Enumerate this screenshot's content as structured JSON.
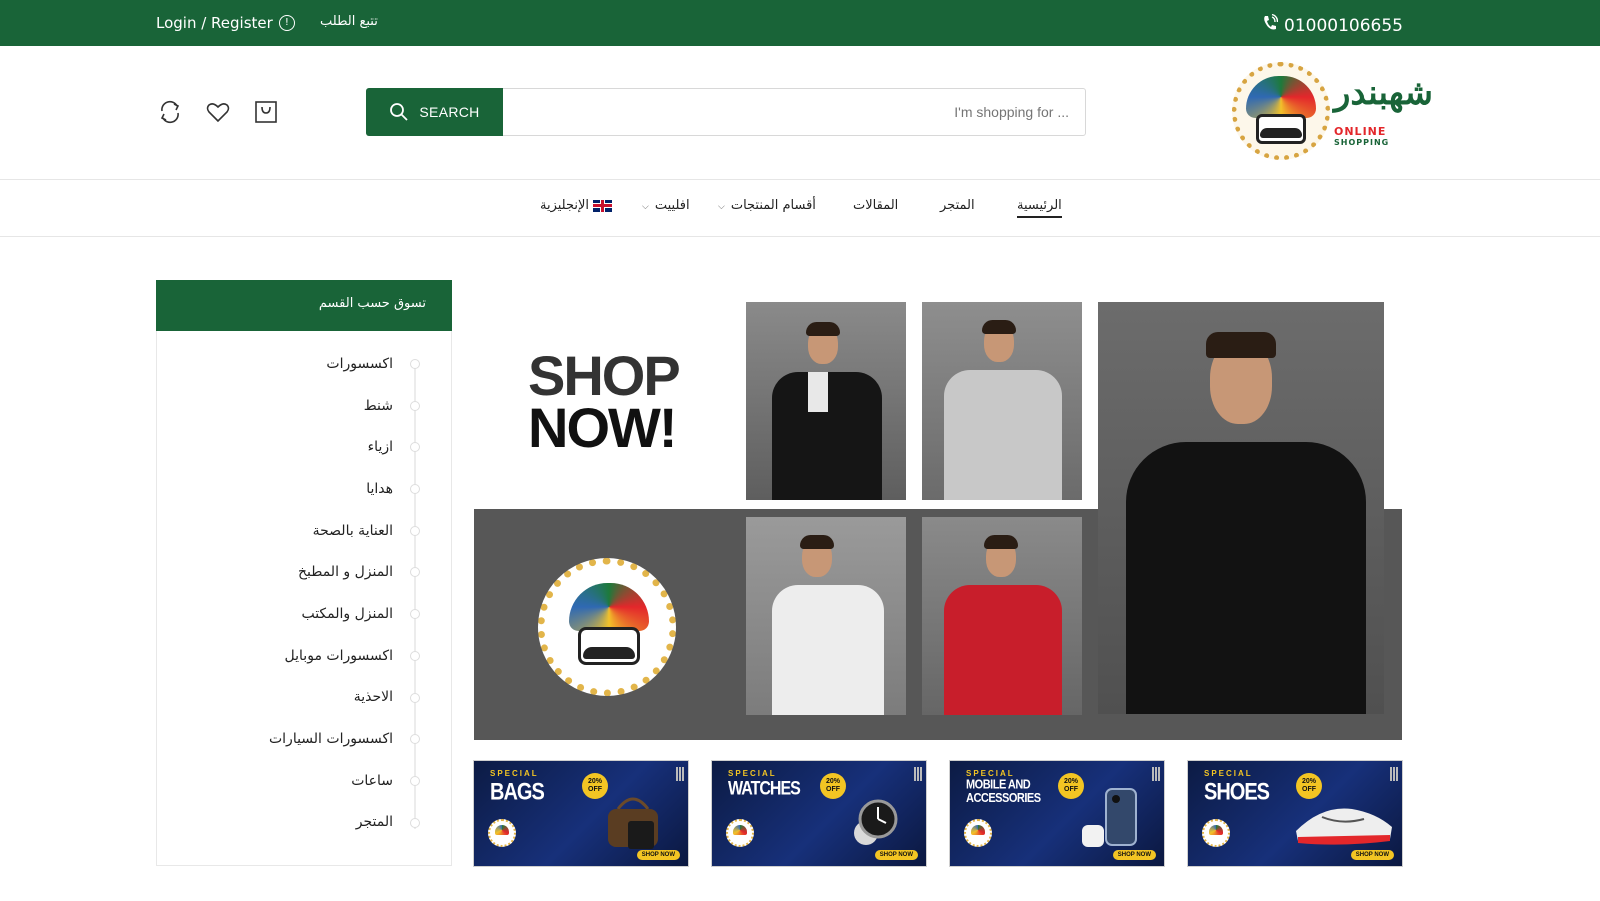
{
  "topbar": {
    "login_label": "Login / Register",
    "track_label": "تتبع الطلب",
    "phone": "01000106655"
  },
  "header": {
    "search_button": "SEARCH",
    "search_placeholder": "... I'm shopping for",
    "icons": [
      "refresh-icon",
      "heart-icon",
      "bag-icon"
    ],
    "logo": {
      "arabic_word": "شهبندر",
      "line1": "ONLINE",
      "line2": "SHOPPING"
    }
  },
  "nav": {
    "items": [
      {
        "label": "الرئيسية",
        "active": true
      },
      {
        "label": "المتجر"
      },
      {
        "label": "المقالات"
      },
      {
        "label": "أقسام المنتجات",
        "dropdown": true
      },
      {
        "label": "افلييت",
        "dropdown": true
      },
      {
        "label": "الإنجليزية",
        "flag": "uk"
      }
    ]
  },
  "categories": {
    "title": "تسوق حسب القسم",
    "items": [
      "اكسسورات",
      "شنط",
      "ازياء",
      "هدايا",
      "العناية بالصحة",
      "المنزل و المطبخ",
      "المنزل والمكتب",
      "اكسسورات موبايل",
      "الاحذية",
      "اكسسورات السيارات",
      "ساعات",
      "المتجر"
    ]
  },
  "hero": {
    "line1": "SHOP",
    "line2": "NOW!"
  },
  "promos": [
    {
      "special": "SPECIAL",
      "name": "BAGS",
      "off_top": "20%",
      "off_bottom": "OFF",
      "cta": "SHOP NOW"
    },
    {
      "special": "SPECIAL",
      "name": "WATCHES",
      "off_top": "20%",
      "off_bottom": "OFF",
      "cta": "SHOP NOW"
    },
    {
      "special": "SPECIAL",
      "name": "MOBILE AND ACCESSORIES",
      "off_top": "20%",
      "off_bottom": "OFF",
      "cta": "SHOP NOW"
    },
    {
      "special": "SPECIAL",
      "name": "SHOES",
      "off_top": "20%",
      "off_bottom": "OFF",
      "cta": "SHOP NOW"
    }
  ],
  "colors": {
    "brand_green": "#196438",
    "promo_navy": "#0c1b44",
    "promo_yellow": "#f3c523"
  }
}
